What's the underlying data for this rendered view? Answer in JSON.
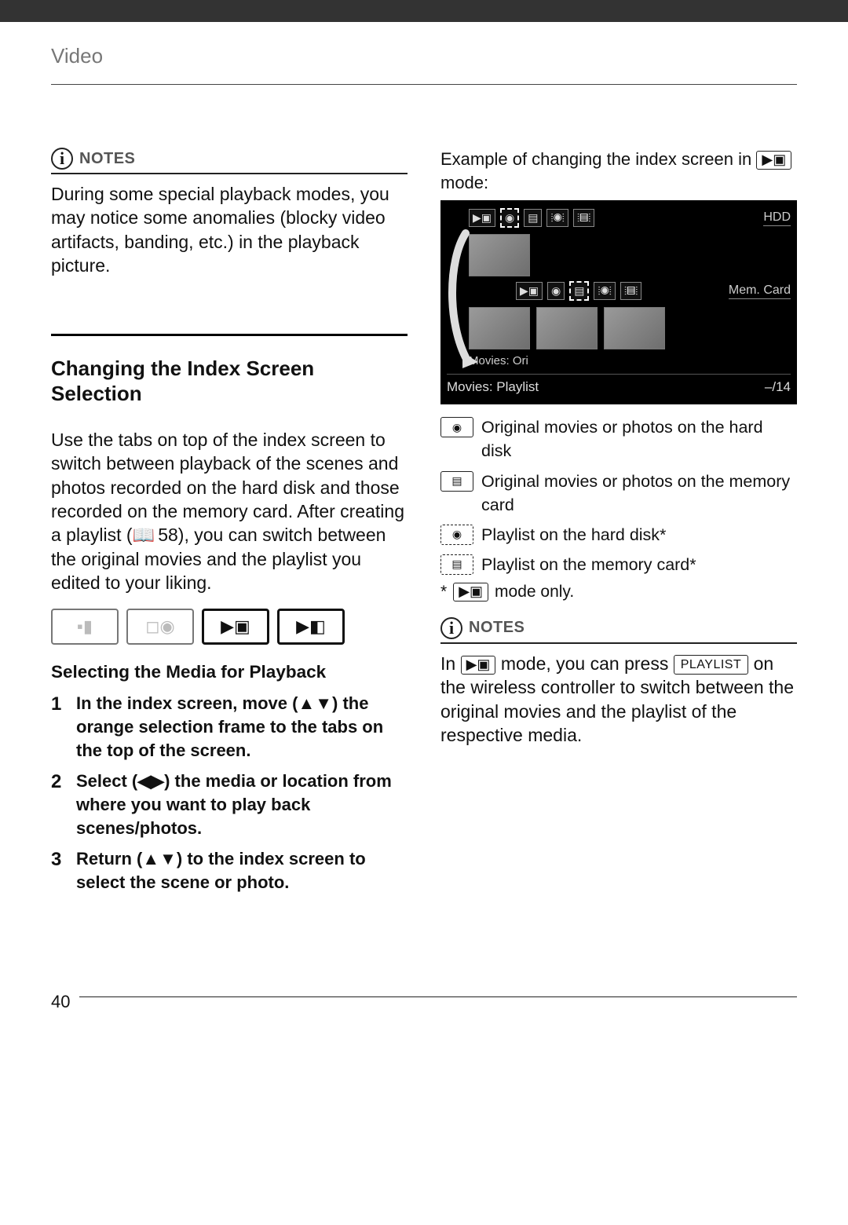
{
  "header": {
    "section_label": "Video"
  },
  "left": {
    "notes_label": "NOTES",
    "notes_body": "During some special playback modes, you may notice some anomalies (blocky video artifacts, banding, etc.) in the playback picture.",
    "h2": "Changing the Index Screen Selection",
    "intro_a": "Use the tabs on top of the index screen to switch between playback of the scenes and photos recorded on the hard disk and those recorded on the memory card. After creating a playlist (",
    "intro_ref": "58",
    "intro_b": "), you can switch between the original movies and the playlist you edited to your liking.",
    "h3": "Selecting the Media for Playback",
    "steps": [
      {
        "n": "1",
        "a": "In the index screen, move (",
        "arrows": "▲▼",
        "b": ") the orange selection frame to the tabs on the top of the screen."
      },
      {
        "n": "2",
        "a": "Select (",
        "arrows": "◀▶",
        "b": ") the media or location from where you want to play back scenes/photos."
      },
      {
        "n": "3",
        "a": "Return (",
        "arrows": "▲▼",
        "b": ") to the index screen to select the scene or photo."
      }
    ]
  },
  "right": {
    "example_a": "Example of changing the index screen in ",
    "example_mode_icon": "▶▣",
    "example_b": " mode:",
    "fig": {
      "storage_top": "HDD",
      "storage_mid": "Mem. Card",
      "row1_label": "Movies: Ori",
      "bottom_label": "Movies: Playlist",
      "bottom_count": "–/14"
    },
    "legend": [
      {
        "icon": "◉",
        "stripe": false,
        "text": "Original movies or photos on the hard disk"
      },
      {
        "icon": "▤",
        "stripe": false,
        "text": "Original movies or photos on the memory card"
      },
      {
        "icon": "◉",
        "stripe": true,
        "text": "Playlist on the hard disk*"
      },
      {
        "icon": "▤",
        "stripe": true,
        "text": "Playlist on the memory card*"
      }
    ],
    "footnote_a": "*",
    "footnote_icon": "▶▣",
    "footnote_b": " mode only.",
    "notes_label": "NOTES",
    "notes2_a": "In ",
    "notes2_mode_icon": "▶▣",
    "notes2_b": " mode, you can press ",
    "notes2_button": "PLAYLIST",
    "notes2_c": " on the wireless controller to switch between the original movies and the playlist of the respective media."
  },
  "page_number": "40"
}
